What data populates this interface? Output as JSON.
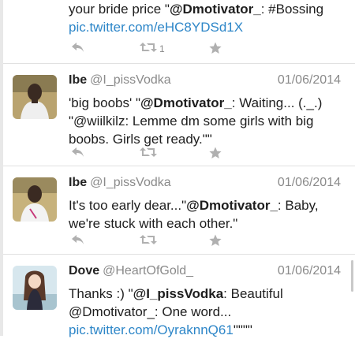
{
  "tweets": [
    {
      "line1_before": "your bride price  \"",
      "line1_mention": "@Dmotivator_",
      "line1_after": ": #Bossing",
      "link": "pic.twitter.com/eHC8YDSd1X",
      "retweet_count": "1"
    },
    {
      "name": "Ibe",
      "handle": "@I_pissVodka",
      "date": "01/06/2014",
      "t1": "'big boobs' \"",
      "m1": "@Dmotivator_",
      "t2": ": Waiting... (._.) \"@wiilkilz: Lemme dm some girls with big boobs. Girls get ready.\"\""
    },
    {
      "name": "Ibe",
      "handle": "@I_pissVodka",
      "date": "01/06/2014",
      "t1": "It's too early dear...\"",
      "m1": "@Dmotivator_",
      "t2": ": Baby, we're stuck with each other.\""
    },
    {
      "name": "Dove",
      "handle": "@HeartOfGold_",
      "date": "01/06/2014",
      "t1": "Thanks :) \"",
      "m1": "@I_pissVodka",
      "t2": ": Beautiful @Dmotivator_: One word... ",
      "link": "pic.twitter.com/OyraknnQ61",
      "t3": "\"\"\"\""
    }
  ],
  "colors": {
    "link": "#2d86c8",
    "meta": "#8a8a8a",
    "icon": "#b0b0b0"
  },
  "icons": [
    "reply-icon",
    "retweet-icon",
    "favorite-icon"
  ]
}
